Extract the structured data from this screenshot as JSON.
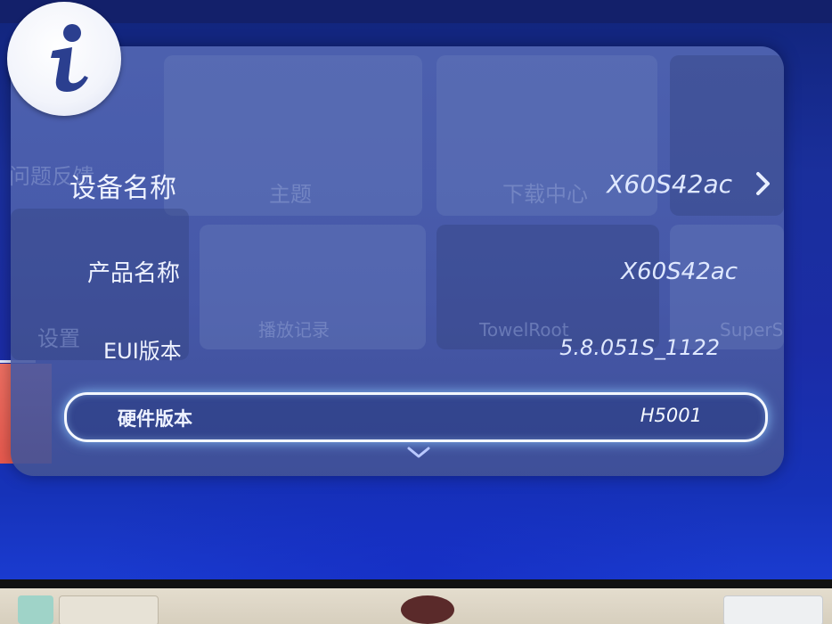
{
  "panel": {
    "info_icon": "info-icon",
    "background_tiles": [
      "主题",
      "下载中心",
      "设置",
      "播放记录",
      "TowelRoot",
      "SuperSU",
      "问题反馈"
    ],
    "rows": [
      {
        "label": "设备名称",
        "value": "X60S42ac",
        "has_chevron": true
      },
      {
        "label": "产品名称",
        "value": "X60S42ac"
      },
      {
        "label": "EUI版本",
        "value": "5.8.051S_1122"
      },
      {
        "label": "硬件版本",
        "value": "H5001",
        "selected": true
      }
    ],
    "more_indicator": "chevron-down-icon"
  },
  "colors": {
    "screen_blue": "#1b2ca6",
    "panel": "#5468b4",
    "highlight_glow": "#8cc8ff",
    "red_tile": "#e8594e"
  }
}
